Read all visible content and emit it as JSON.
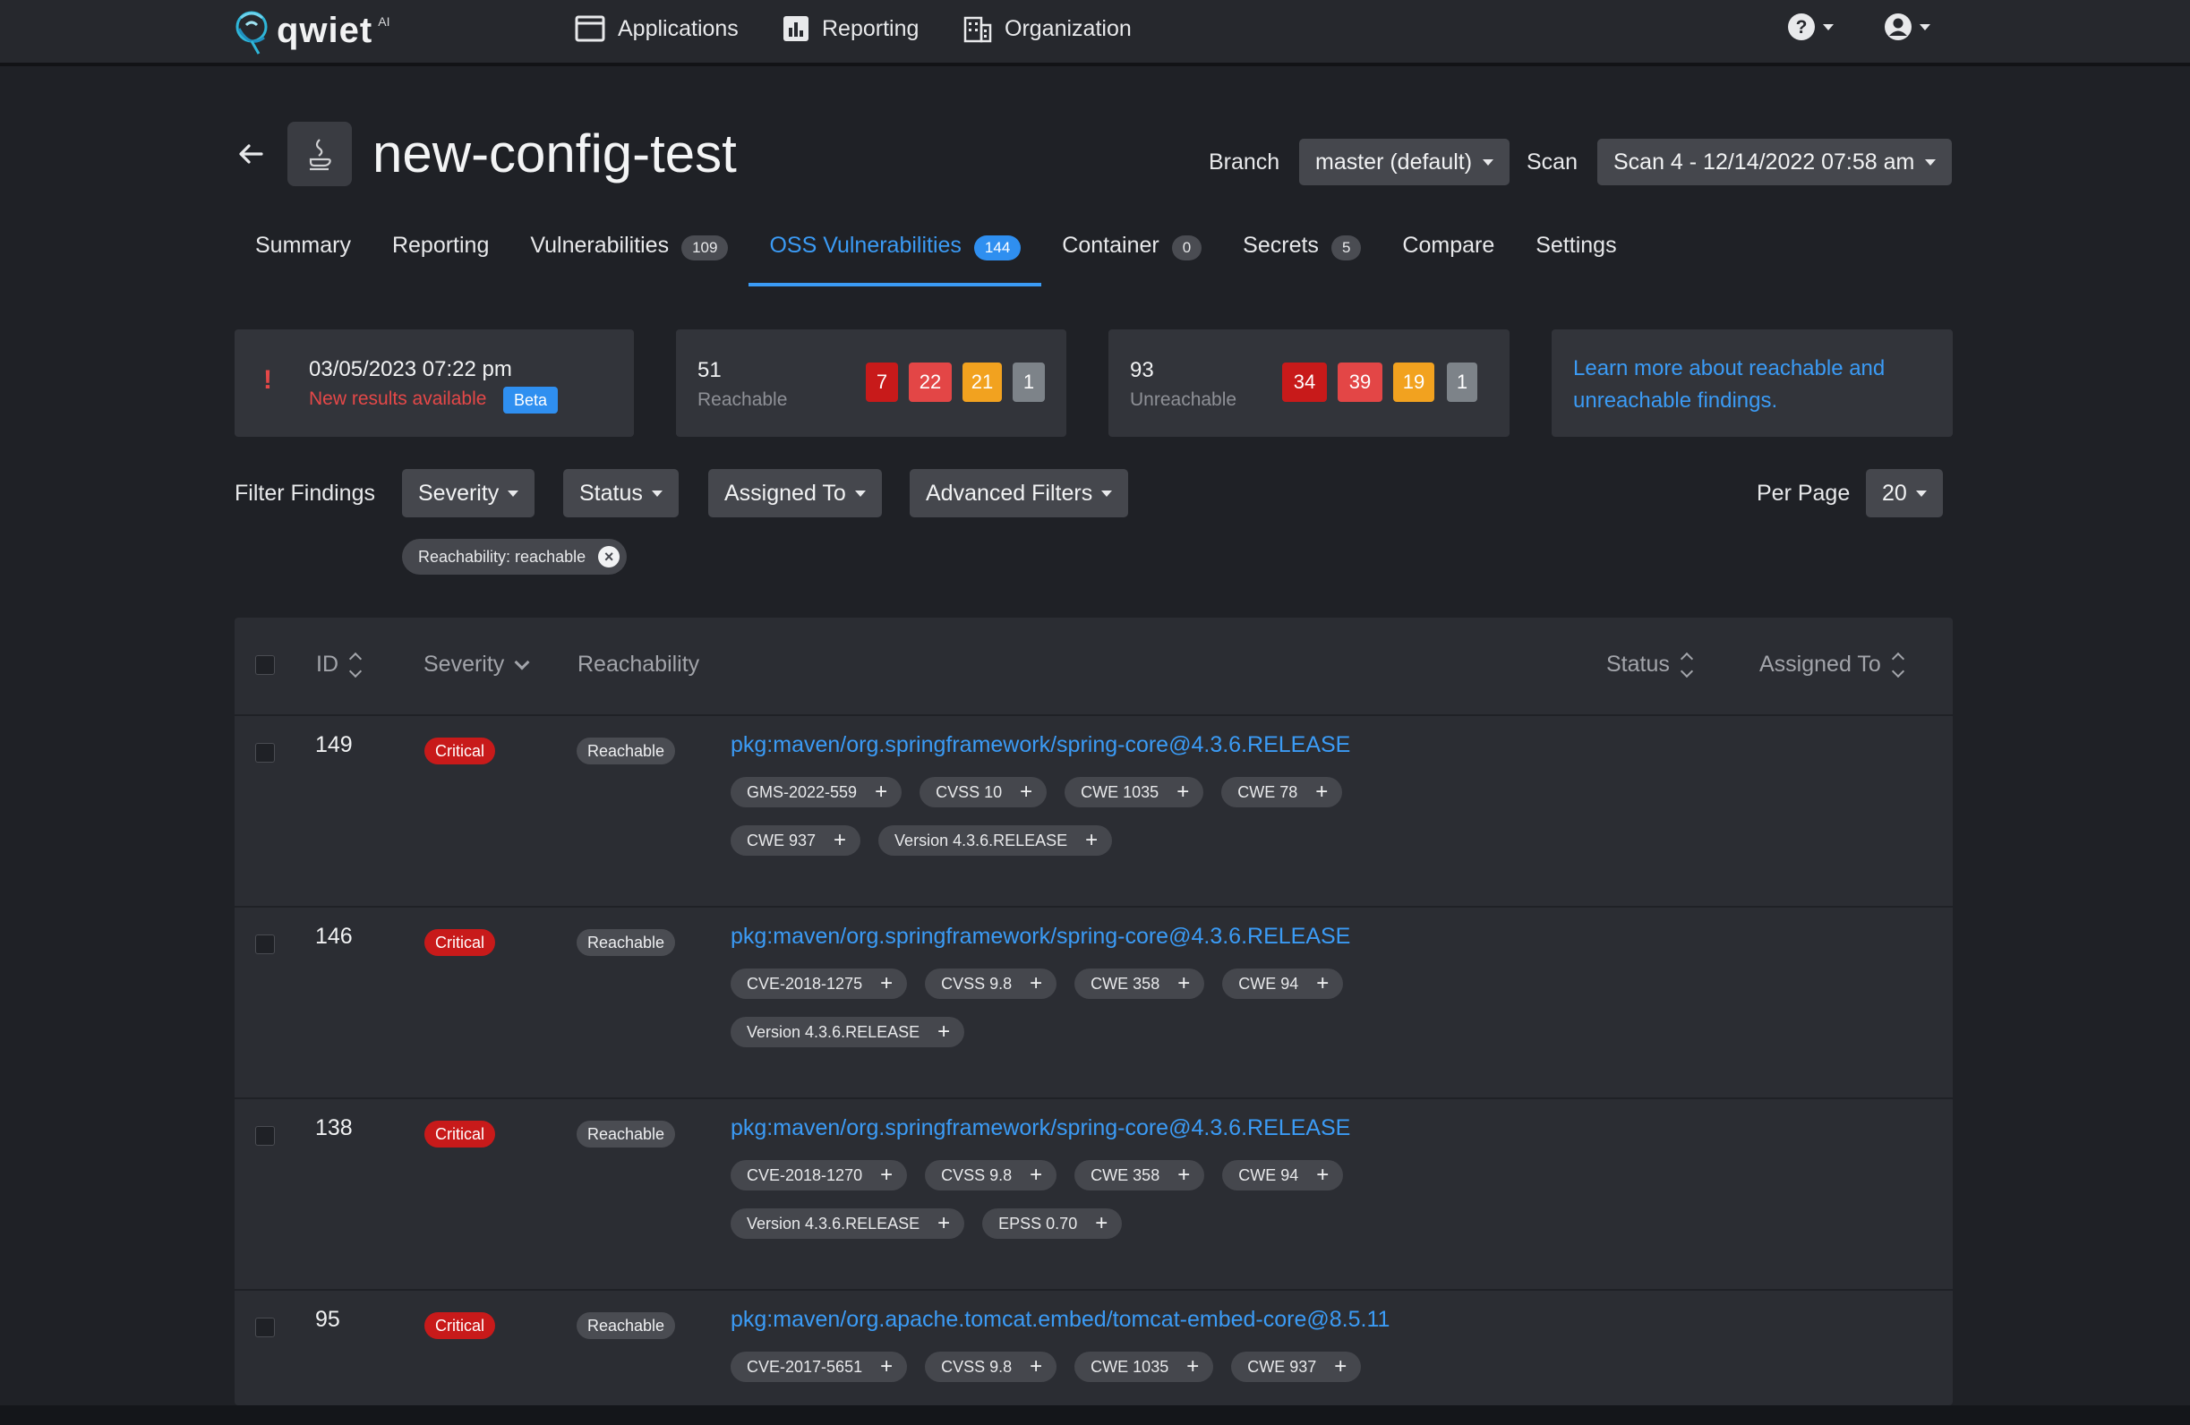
{
  "nav": {
    "logo_text": "qwiet",
    "logo_sup": "AI",
    "items": [
      {
        "label": "Applications",
        "icon": "window-icon"
      },
      {
        "label": "Reporting",
        "icon": "bar-chart-icon"
      },
      {
        "label": "Organization",
        "icon": "building-icon"
      }
    ],
    "help_icon": "question-circle-icon",
    "user_icon": "user-circle-icon"
  },
  "header": {
    "title": "new-config-test",
    "language_icon": "java-icon",
    "branch_label": "Branch",
    "branch_value": "master (default)",
    "scan_label": "Scan",
    "scan_value": "Scan 4 - 12/14/2022 07:58 am"
  },
  "tabs": [
    {
      "label": "Summary",
      "count": null
    },
    {
      "label": "Reporting",
      "count": null
    },
    {
      "label": "Vulnerabilities",
      "count": "109"
    },
    {
      "label": "OSS Vulnerabilities",
      "count": "144",
      "active": true
    },
    {
      "label": "Container",
      "count": "0"
    },
    {
      "label": "Secrets",
      "count": "5"
    },
    {
      "label": "Compare",
      "count": null
    },
    {
      "label": "Settings",
      "count": null
    }
  ],
  "cards": {
    "alert": {
      "icon": "!",
      "date": "03/05/2023 07:22 pm",
      "message": "New results available",
      "badge": "Beta"
    },
    "reachable": {
      "count": "51",
      "label": "Reachable",
      "severity": [
        "7",
        "22",
        "21",
        "1"
      ]
    },
    "unreachable": {
      "count": "93",
      "label": "Unreachable",
      "severity": [
        "34",
        "39",
        "19",
        "1"
      ]
    },
    "learn": {
      "line1": "Learn more about reachable and",
      "line2": "unreachable findings."
    }
  },
  "filters": {
    "label": "Filter Findings",
    "severity": "Severity",
    "status": "Status",
    "assigned": "Assigned To",
    "advanced": "Advanced Filters",
    "per_page_label": "Per Page",
    "per_page_value": "20",
    "active_chip": "Reachability: reachable"
  },
  "table": {
    "headers": {
      "id": "ID",
      "severity": "Severity",
      "reachability": "Reachability",
      "status": "Status",
      "assigned": "Assigned To"
    },
    "rows": [
      {
        "id": "149",
        "severity": "Critical",
        "reachability": "Reachable",
        "package": "pkg:maven/org.springframework/spring-core@4.3.6.RELEASE",
        "tags": [
          "GMS-2022-559",
          "CVSS 10",
          "CWE 1035",
          "CWE 78",
          "CWE 937",
          "Version 4.3.6.RELEASE"
        ]
      },
      {
        "id": "146",
        "severity": "Critical",
        "reachability": "Reachable",
        "package": "pkg:maven/org.springframework/spring-core@4.3.6.RELEASE",
        "tags": [
          "CVE-2018-1275",
          "CVSS 9.8",
          "CWE 358",
          "CWE 94",
          "Version 4.3.6.RELEASE"
        ]
      },
      {
        "id": "138",
        "severity": "Critical",
        "reachability": "Reachable",
        "package": "pkg:maven/org.springframework/spring-core@4.3.6.RELEASE",
        "tags": [
          "CVE-2018-1270",
          "CVSS 9.8",
          "CWE 358",
          "CWE 94",
          "Version 4.3.6.RELEASE",
          "EPSS 0.70"
        ]
      },
      {
        "id": "95",
        "severity": "Critical",
        "reachability": "Reachable",
        "package": "pkg:maven/org.apache.tomcat.embed/tomcat-embed-core@8.5.11",
        "tags": [
          "CVE-2017-5651",
          "CVSS 9.8",
          "CWE 1035",
          "CWE 937"
        ]
      }
    ]
  },
  "colors": {
    "accent": "#3b9bf5",
    "critical": "#c81a1a",
    "high": "#e34646",
    "medium": "#f2a21f",
    "low": "#7d8389",
    "alert_text": "#e54848"
  }
}
